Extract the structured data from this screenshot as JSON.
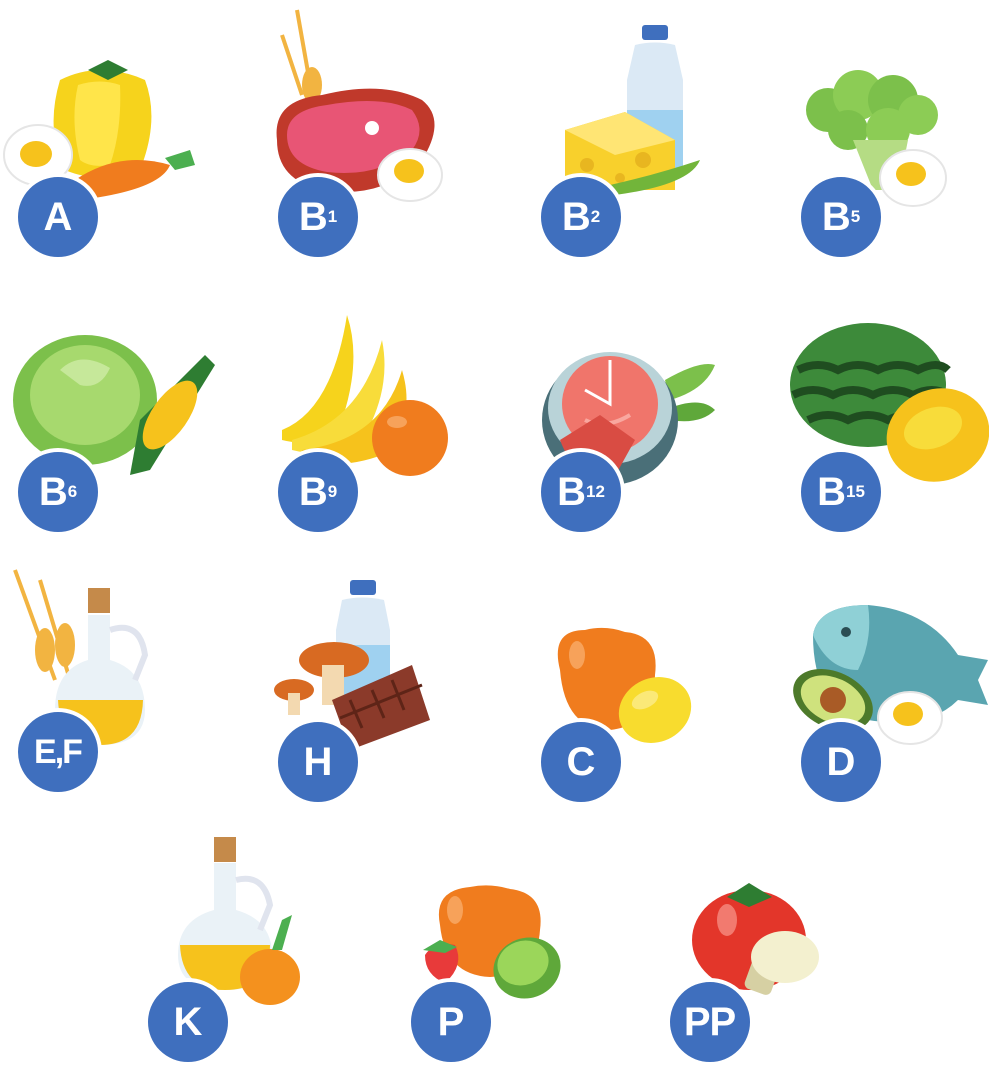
{
  "vitamins": [
    {
      "letter": "A",
      "sub": ""
    },
    {
      "letter": "B",
      "sub": "1"
    },
    {
      "letter": "B",
      "sub": "2"
    },
    {
      "letter": "B",
      "sub": "5"
    },
    {
      "letter": "B",
      "sub": "6"
    },
    {
      "letter": "B",
      "sub": "9"
    },
    {
      "letter": "B",
      "sub": "12"
    },
    {
      "letter": "B",
      "sub": "15"
    },
    {
      "letter": "E,F",
      "sub": ""
    },
    {
      "letter": "H",
      "sub": ""
    },
    {
      "letter": "C",
      "sub": ""
    },
    {
      "letter": "D",
      "sub": ""
    },
    {
      "letter": "K",
      "sub": ""
    },
    {
      "letter": "P",
      "sub": ""
    },
    {
      "letter": "PP",
      "sub": ""
    }
  ],
  "colors": {
    "badge": "#3f6fbe",
    "badge_text": "#ffffff",
    "background": "#ffffff"
  }
}
